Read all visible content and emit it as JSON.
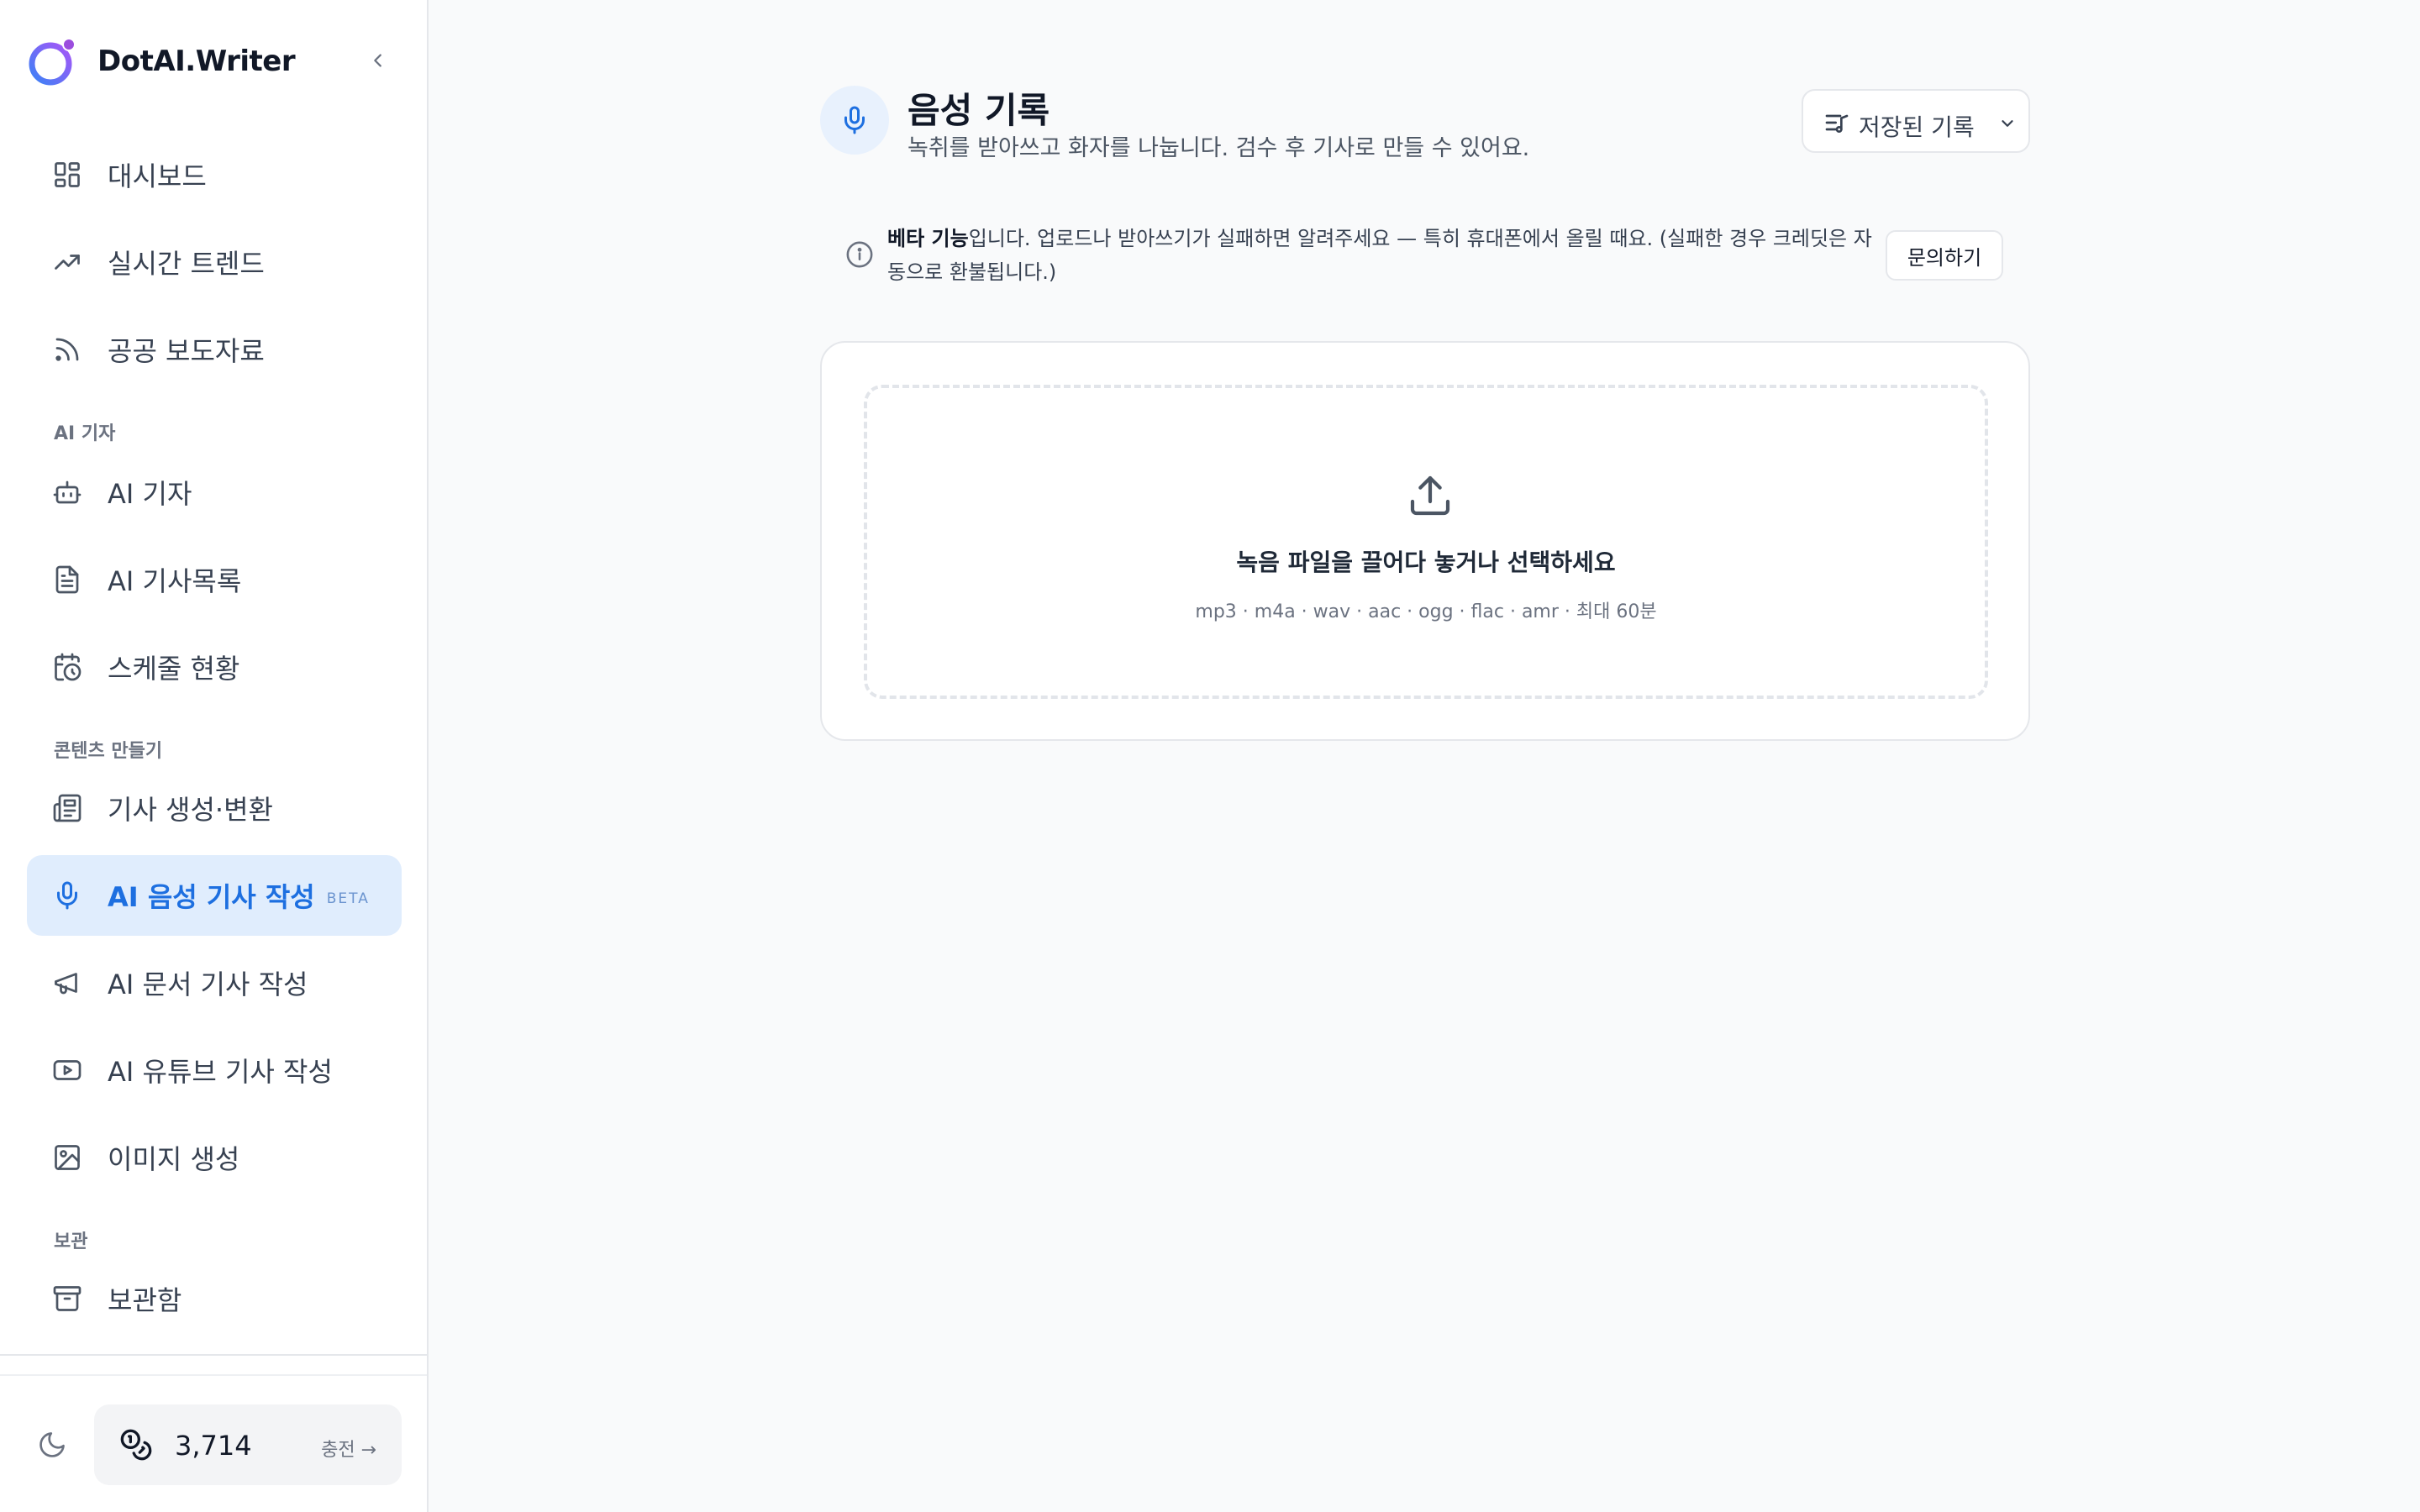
{
  "brand": {
    "name": "DotAI.Writer"
  },
  "sidebar": {
    "items": [
      {
        "label": "대시보드"
      },
      {
        "label": "실시간 트렌드"
      },
      {
        "label": "공공 보도자료"
      },
      {
        "label": "AI 기자"
      },
      {
        "label": "AI 기사목록"
      },
      {
        "label": "스케줄 현황"
      },
      {
        "label": "기사 생성·변환"
      },
      {
        "label": "AI 음성 기사 작성",
        "badge": "BETA"
      },
      {
        "label": "AI 문서 기사 작성"
      },
      {
        "label": "AI 유튜브 기사 작성"
      },
      {
        "label": "이미지 생성"
      },
      {
        "label": "보관함"
      }
    ],
    "sections": [
      "AI 기자",
      "콘텐츠 만들기",
      "보관"
    ],
    "credits": {
      "amount": "3,714",
      "charge_label": "충전 →"
    }
  },
  "header": {
    "title": "음성 기록",
    "subtitle": "녹취를 받아쓰고 화자를 나눕니다. 검수 후 기사로 만들 수 있어요.",
    "saved_button": "저장된 기록"
  },
  "notice": {
    "bold": "베타 기능",
    "text": "입니다. 업로드나 받아쓰기가 실패하면 알려주세요 — 특히 휴대폰에서 올릴 때요. (실패한 경우 크레딧은 자동으로 환불됩니다.)",
    "button": "문의하기"
  },
  "upload": {
    "title": "녹음 파일을 끌어다 놓거나 선택하세요",
    "formats": "mp3 · m4a · wav · aac · ogg · flac · amr · 최대 60분"
  },
  "colors": {
    "accent": "#1d6fe0",
    "active_bg": "#e0edfd"
  }
}
